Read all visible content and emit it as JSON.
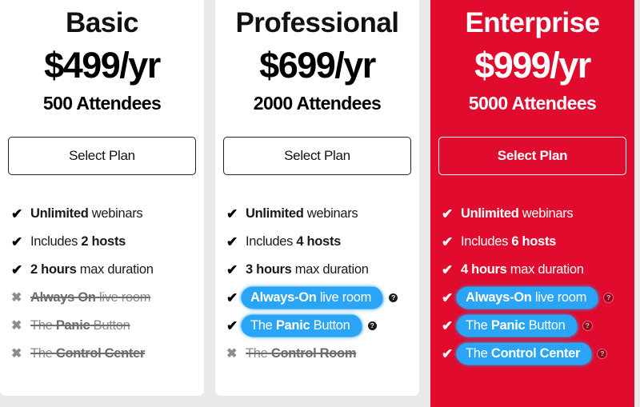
{
  "icons": {
    "check": "✔",
    "cross": "✖",
    "help": "?"
  },
  "colors": {
    "featured_background": "#e00b2d",
    "highlight": "#2aa4f4",
    "page_background": "#e9e9e9",
    "card_background": "#ffffff",
    "disabled_text": "#8a8a8a"
  },
  "plans": [
    {
      "name": "Basic",
      "price": "$499/yr",
      "attendees": "500 Attendees",
      "cta": "Select Plan",
      "featured": false,
      "features": [
        {
          "bold_lead": "Unlimited",
          "rest": " webinars",
          "included": true,
          "highlighted": false,
          "help": false
        },
        {
          "bold_lead": "",
          "lead": "Includes ",
          "bold_tail": "2 hosts",
          "included": true,
          "highlighted": false,
          "help": false
        },
        {
          "bold_lead": "2 hours",
          "rest": " max duration",
          "included": true,
          "highlighted": false,
          "help": false
        },
        {
          "bold_lead": "Always On",
          "rest": " live room",
          "included": false,
          "highlighted": false,
          "help": false
        },
        {
          "bold_lead": "",
          "lead": "The ",
          "bold_tail": "Panic",
          "tail": " Button",
          "included": false,
          "highlighted": false,
          "help": false
        },
        {
          "bold_lead": "",
          "lead": "The ",
          "bold_tail": "Control Center",
          "included": false,
          "highlighted": false,
          "help": false
        }
      ]
    },
    {
      "name": "Professional",
      "price": "$699/yr",
      "attendees": "2000 Attendees",
      "cta": "Select Plan",
      "featured": false,
      "features": [
        {
          "bold_lead": "Unlimited",
          "rest": " webinars",
          "included": true,
          "highlighted": false,
          "help": false
        },
        {
          "bold_lead": "",
          "lead": "Includes ",
          "bold_tail": "4 hosts",
          "included": true,
          "highlighted": false,
          "help": false
        },
        {
          "bold_lead": "3 hours",
          "rest": " max duration",
          "included": true,
          "highlighted": false,
          "help": false
        },
        {
          "bold_lead": "Always-On",
          "rest": " live room",
          "included": true,
          "highlighted": true,
          "help": true
        },
        {
          "bold_lead": "",
          "lead": "The ",
          "bold_tail": "Panic",
          "tail": " Button",
          "included": true,
          "highlighted": true,
          "help": true
        },
        {
          "bold_lead": "",
          "lead": "The ",
          "bold_tail": "Control Room",
          "included": false,
          "highlighted": false,
          "help": false
        }
      ]
    },
    {
      "name": "Enterprise",
      "price": "$999/yr",
      "attendees": "5000 Attendees",
      "cta": "Select Plan",
      "featured": true,
      "features": [
        {
          "bold_lead": "Unlimited",
          "rest": " webinars",
          "included": true,
          "highlighted": false,
          "help": false
        },
        {
          "bold_lead": "",
          "lead": "Includes ",
          "bold_tail": "6 hosts",
          "included": true,
          "highlighted": false,
          "help": false
        },
        {
          "bold_lead": "4 hours",
          "rest": " max duration",
          "included": true,
          "highlighted": false,
          "help": false
        },
        {
          "bold_lead": "Always-On",
          "rest": " live room",
          "included": true,
          "highlighted": true,
          "help": true
        },
        {
          "bold_lead": "",
          "lead": "The ",
          "bold_tail": "Panic",
          "tail": " Button",
          "included": true,
          "highlighted": true,
          "help": true
        },
        {
          "bold_lead": "",
          "lead": "The ",
          "bold_tail": "Control Center",
          "included": true,
          "highlighted": true,
          "help": true
        }
      ]
    }
  ]
}
